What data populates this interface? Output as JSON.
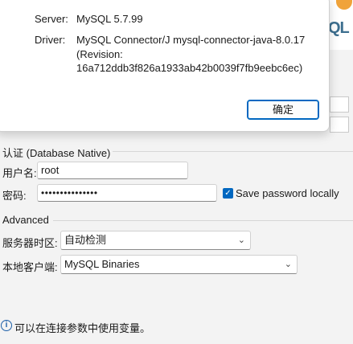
{
  "dialog": {
    "server_label": "Server:",
    "server_value": "MySQL 5.7.99",
    "driver_label": "Driver:",
    "driver_line1": "MySQL Connector/J mysql-connector-java-8.0.17",
    "driver_line2": "(Revision:",
    "driver_line3": "16a712ddb3f826a1933ab42b0039f7fb9eebc6ec)",
    "ok_label": "确定"
  },
  "logo": {
    "text": "QL"
  },
  "auth": {
    "section_title": "认证 (Database Native)",
    "username_label": "用户名:",
    "username_value": "root",
    "password_label": "密码:",
    "password_value": "•••••••••••••••",
    "save_password_label": "Save password locally",
    "save_password_checked": true
  },
  "advanced": {
    "section_title": "Advanced",
    "timezone_label": "服务器时区:",
    "timezone_value": "自动检测",
    "client_label": "本地客户端:",
    "client_value": "MySQL Binaries"
  },
  "footer": {
    "info_text": "可以在连接参数中使用变量。"
  },
  "icons": {
    "checkmark": "✓",
    "chevron": "⌄",
    "info": "i"
  }
}
